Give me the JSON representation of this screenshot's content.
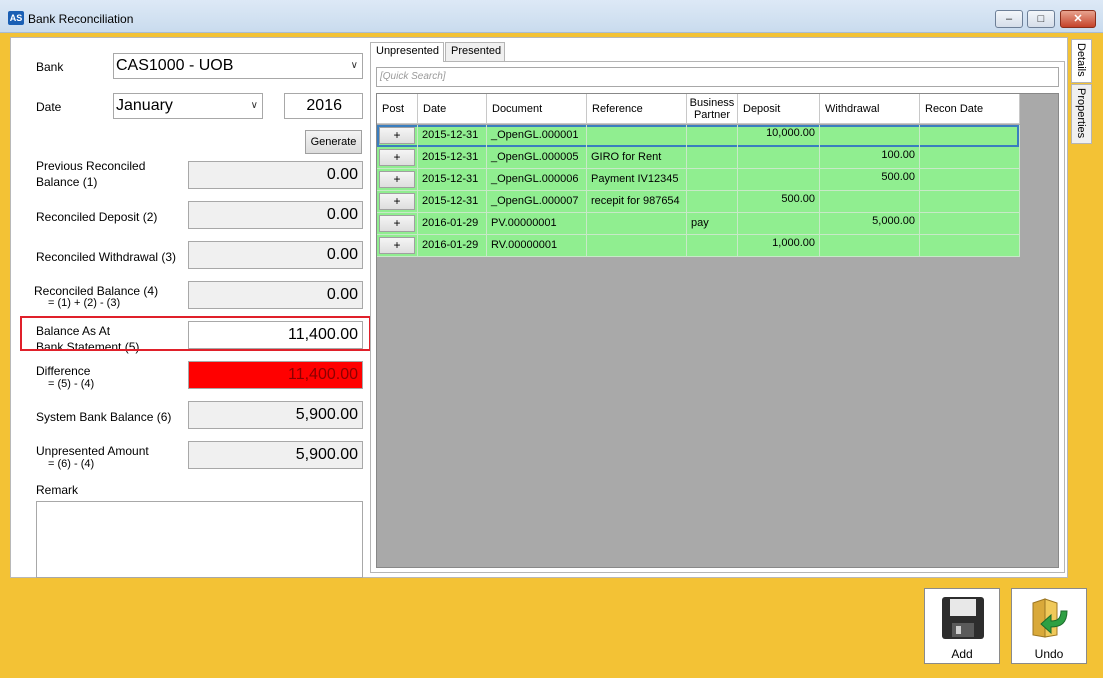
{
  "window": {
    "app_icon": "AS",
    "title": "Bank Reconciliation",
    "minimize": "–",
    "maximize": "□",
    "close": "✕"
  },
  "form": {
    "bank_label": "Bank",
    "bank_value": "CAS1000 - UOB",
    "date_label": "Date",
    "month_value": "January",
    "year_value": "2016",
    "generate_label": "Generate",
    "prev_reconciled_label": "Previous Reconciled",
    "prev_reconciled_label2": "Balance (1)",
    "prev_reconciled_value": "0.00",
    "reconciled_deposit_label": "Reconciled Deposit (2)",
    "reconciled_deposit_value": "0.00",
    "reconciled_withdrawal_label": "Reconciled Withdrawal (3)",
    "reconciled_withdrawal_value": "0.00",
    "reconciled_balance_label": "Reconciled Balance (4)",
    "reconciled_balance_formula": "= (1) + (2) - (3)",
    "reconciled_balance_value": "0.00",
    "balance_as_at_label": "Balance As At",
    "balance_as_at_label2": "Bank Statement (5)",
    "balance_as_at_value": "11,400.00",
    "difference_label": "Difference",
    "difference_formula": "= (5) - (4)",
    "difference_value": "11,400.00",
    "system_balance_label": "System Bank Balance (6)",
    "system_balance_value": "5,900.00",
    "unpresented_label": "Unpresented Amount",
    "unpresented_formula": "= (6) - (4)",
    "unpresented_value": "5,900.00",
    "remark_label": "Remark"
  },
  "tabs": [
    "Unpresented",
    "Presented"
  ],
  "side_tabs": [
    "Details",
    "Properties"
  ],
  "search_placeholder": "[Quick Search]",
  "grid": {
    "headers": [
      "Post",
      "Date",
      "Document",
      "Reference",
      "Business Partner",
      "Deposit",
      "Withdrawal",
      "Recon Date"
    ],
    "post_symbol": "+",
    "rows": [
      {
        "date": "2015-12-31",
        "document": "_OpenGL.000001",
        "reference": "",
        "partner": "",
        "deposit": "10,000.00",
        "withdrawal": "",
        "recon": ""
      },
      {
        "date": "2015-12-31",
        "document": "_OpenGL.000005",
        "reference": "GIRO for Rent",
        "partner": "",
        "deposit": "",
        "withdrawal": "100.00",
        "recon": ""
      },
      {
        "date": "2015-12-31",
        "document": "_OpenGL.000006",
        "reference": "Payment IV12345",
        "partner": "",
        "deposit": "",
        "withdrawal": "500.00",
        "recon": ""
      },
      {
        "date": "2015-12-31",
        "document": "_OpenGL.000007",
        "reference": "recepit for 987654",
        "partner": "",
        "deposit": "500.00",
        "withdrawal": "",
        "recon": ""
      },
      {
        "date": "2016-01-29",
        "document": "PV.00000001",
        "reference": "",
        "partner": "pay",
        "deposit": "",
        "withdrawal": "5,000.00",
        "recon": ""
      },
      {
        "date": "2016-01-29",
        "document": "RV.00000001",
        "reference": "",
        "partner": "",
        "deposit": "1,000.00",
        "withdrawal": "",
        "recon": ""
      }
    ]
  },
  "buttons": {
    "add_label": "Add",
    "undo_label": "Undo"
  },
  "colors": {
    "frame": "#f3c235",
    "row": "#90ee90",
    "difference": "#ff0000",
    "highlight": "#e0202a"
  }
}
